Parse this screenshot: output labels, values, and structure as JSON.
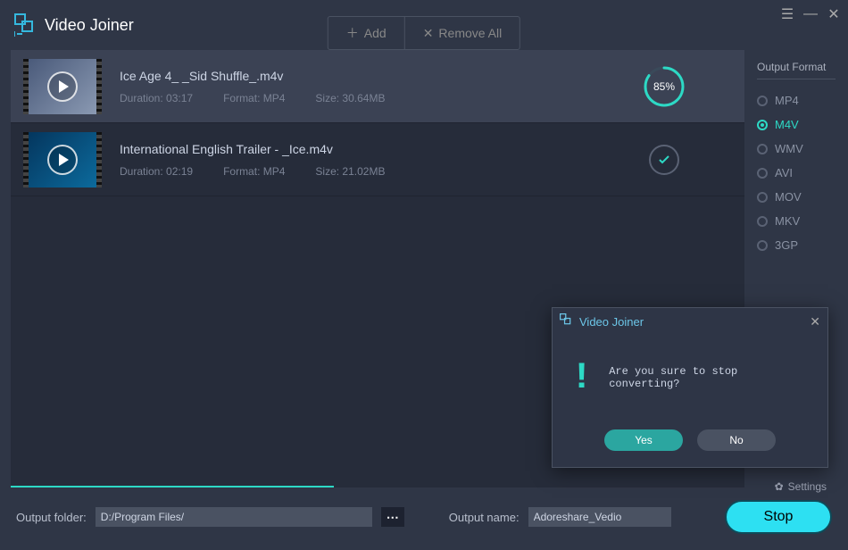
{
  "app_title": "Video Joiner",
  "toolbar": {
    "add_label": "Add",
    "remove_label": "Remove All"
  },
  "items": [
    {
      "title": "Ice Age 4_ _Sid Shuffle_.m4v",
      "duration_label": "Duration: 03:17",
      "format_label": "Format: MP4",
      "size_label": "Size: 30.64MB",
      "progress_pct": "85%",
      "progress_val": 85
    },
    {
      "title": "International English Trailer - _Ice.m4v",
      "duration_label": "Duration: 02:19",
      "format_label": "Format: MP4",
      "size_label": "Size: 21.02MB",
      "done": true
    }
  ],
  "sidebar": {
    "title": "Output Format",
    "formats": [
      "MP4",
      "M4V",
      "WMV",
      "AVI",
      "MOV",
      "MKV",
      "3GP"
    ],
    "selected": "M4V"
  },
  "settings_label": "Settings",
  "footer": {
    "folder_label": "Output folder:",
    "folder_value": "D:/Program Files/",
    "name_label": "Output name:",
    "name_value": "Adoreshare_Vedio",
    "stop_label": "Stop"
  },
  "dialog": {
    "title": "Video Joiner",
    "message": "Are you sure to stop converting?",
    "yes": "Yes",
    "no": "No"
  }
}
